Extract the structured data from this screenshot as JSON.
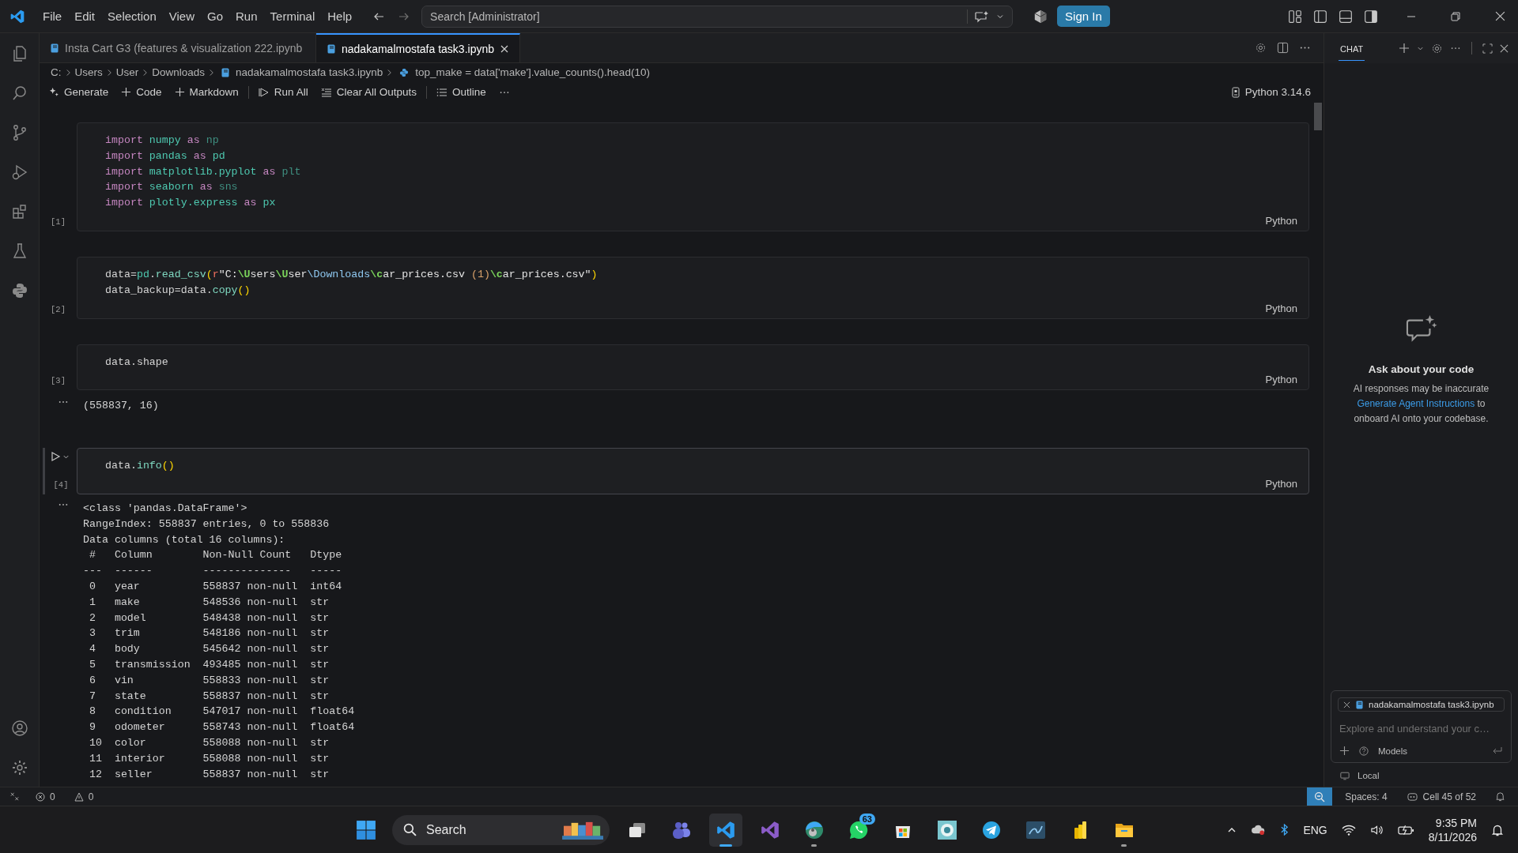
{
  "menu": [
    "File",
    "Edit",
    "Selection",
    "View",
    "Go",
    "Run",
    "Terminal",
    "Help"
  ],
  "search": {
    "placeholder": "Search [Administrator]"
  },
  "sign_in": "Sign In",
  "tabs": [
    {
      "label": "Insta Cart G3 (features & visualization 222.ipynb",
      "selected": false
    },
    {
      "label": "nadakamalmostafa task3.ipynb",
      "selected": true
    }
  ],
  "breadcrumb": [
    {
      "label": "C:",
      "kind": "folder"
    },
    {
      "label": "Users",
      "kind": "folder"
    },
    {
      "label": "User",
      "kind": "folder"
    },
    {
      "label": "Downloads",
      "kind": "folder"
    },
    {
      "label": "nadakamalmostafa task3.ipynb",
      "kind": "notebook"
    },
    {
      "label": "top_make = data['make'].value_counts().head(10)",
      "kind": "symbol"
    }
  ],
  "toolbar": [
    [
      {
        "label": "Generate",
        "kind": "generate"
      },
      {
        "label": "Code",
        "kind": "add"
      },
      {
        "label": "Markdown",
        "kind": "add"
      }
    ],
    [
      {
        "label": "Run All",
        "kind": "run"
      },
      {
        "label": "Clear All Outputs",
        "kind": "clear"
      }
    ],
    [
      {
        "label": "Outline",
        "kind": "outline"
      }
    ]
  ],
  "kernel": "Python 3.14.6",
  "cells": [
    {
      "count": "[1]",
      "language": "Python",
      "focused": false,
      "lines": [
        [
          {
            "text": "import ",
            "kind": "keyword"
          },
          {
            "text": "numpy ",
            "kind": "module"
          },
          {
            "text": "as ",
            "kind": "keyword"
          },
          {
            "text": "np",
            "kind": "alias_dim"
          }
        ],
        [
          {
            "text": "import ",
            "kind": "keyword"
          },
          {
            "text": "pandas ",
            "kind": "module"
          },
          {
            "text": "as ",
            "kind": "keyword"
          },
          {
            "text": "pd",
            "kind": "module"
          }
        ],
        [
          {
            "text": "import ",
            "kind": "keyword"
          },
          {
            "text": "matplotlib.pyplot ",
            "kind": "module"
          },
          {
            "text": "as ",
            "kind": "keyword"
          },
          {
            "text": "plt",
            "kind": "alias_dim"
          }
        ],
        [
          {
            "text": "import ",
            "kind": "keyword"
          },
          {
            "text": "seaborn ",
            "kind": "module"
          },
          {
            "text": "as ",
            "kind": "keyword"
          },
          {
            "text": "sns",
            "kind": "alias_dim"
          }
        ],
        [
          {
            "text": "import ",
            "kind": "keyword"
          },
          {
            "text": "plotly.express ",
            "kind": "module"
          },
          {
            "text": "as ",
            "kind": "keyword"
          },
          {
            "text": "px",
            "kind": "module"
          }
        ]
      ]
    },
    {
      "count": "[2]",
      "language": "Python",
      "focused": false,
      "lines": [
        [
          {
            "text": "data=",
            "kind": "plain"
          },
          {
            "text": "pd",
            "kind": "module"
          },
          {
            "text": ".",
            "kind": "plain"
          },
          {
            "text": "read_csv",
            "kind": "func"
          },
          {
            "text": "(",
            "kind": "paren"
          },
          {
            "text": "r",
            "kind": "prefix"
          },
          {
            "text": "\"C:",
            "kind": "string"
          },
          {
            "text": "\\U",
            "kind": "escape"
          },
          {
            "text": "sers",
            "kind": "string"
          },
          {
            "text": "\\U",
            "kind": "escape"
          },
          {
            "text": "ser",
            "kind": "string"
          },
          {
            "text": "\\Downloads",
            "kind": "path"
          },
          {
            "text": "\\c",
            "kind": "escape"
          },
          {
            "text": "ar_prices.csv ",
            "kind": "string"
          },
          {
            "text": "(1)",
            "kind": "string_paren"
          },
          {
            "text": "\\c",
            "kind": "escape"
          },
          {
            "text": "ar_prices.csv\"",
            "kind": "string"
          },
          {
            "text": ")",
            "kind": "paren"
          }
        ],
        [
          {
            "text": "data_backup=data.",
            "kind": "plain"
          },
          {
            "text": "copy",
            "kind": "func"
          },
          {
            "text": "()",
            "kind": "paren"
          }
        ]
      ]
    },
    {
      "count": "[3]",
      "language": "Python",
      "focused": false,
      "lines": [
        [
          {
            "text": "data.shape",
            "kind": "plain"
          }
        ]
      ],
      "output": [
        "(558837, 16)"
      ]
    },
    {
      "count": "[4]",
      "language": "Python",
      "focused": true,
      "lines": [
        [
          {
            "text": "data.",
            "kind": "plain"
          },
          {
            "text": "info",
            "kind": "func"
          },
          {
            "text": "()",
            "kind": "paren"
          }
        ]
      ],
      "output": [
        "<class 'pandas.DataFrame'>",
        "RangeIndex: 558837 entries, 0 to 558836",
        "Data columns (total 16 columns):",
        " #   Column        Non-Null Count   Dtype",
        "---  ------        --------------   -----",
        " 0   year          558837 non-null  int64",
        " 1   make          548536 non-null  str",
        " 2   model         548438 non-null  str",
        " 3   trim          548186 non-null  str",
        " 4   body          545642 non-null  str",
        " 5   transmission  493485 non-null  str",
        " 6   vin           558833 non-null  str",
        " 7   state         558837 non-null  str",
        " 8   condition     547017 non-null  float64",
        " 9   odometer      558743 non-null  float64",
        " 10  color         558088 non-null  str",
        " 11  interior      558088 non-null  str",
        " 12  seller        558837 non-null  str"
      ]
    }
  ],
  "chat": {
    "tab": "CHAT",
    "title": "Ask about your code",
    "note": "AI responses may be inaccurate",
    "link": "Generate Agent Instructions",
    "note_rest": "to onboard AI onto your codebase.",
    "attachment": "nadakamalmostafa task3.ipynb",
    "placeholder": "Explore and understand your c…",
    "models": "Models",
    "local": "Local"
  },
  "status": {
    "errors": "0",
    "warnings": "0",
    "spaces": "Spaces: 4",
    "cell": "Cell 45 of 52"
  },
  "taskbar": {
    "search": "Search",
    "apps": [
      {
        "kind": "taskview",
        "selected": false,
        "running": false
      },
      {
        "kind": "teams",
        "selected": false,
        "running": false
      },
      {
        "kind": "vscode",
        "selected": true,
        "running": true
      },
      {
        "kind": "vs",
        "selected": false,
        "running": false
      },
      {
        "kind": "browser",
        "selected": false,
        "running": true
      },
      {
        "kind": "whatsapp",
        "selected": false,
        "running": false,
        "badge": "63"
      },
      {
        "kind": "store",
        "selected": false,
        "running": false
      },
      {
        "kind": "pattern",
        "selected": false,
        "running": false
      },
      {
        "kind": "telegram",
        "selected": false,
        "running": false
      },
      {
        "kind": "workbench",
        "selected": false,
        "running": false
      },
      {
        "kind": "powerbi",
        "selected": false,
        "running": false
      },
      {
        "kind": "folder",
        "selected": false,
        "running": true
      }
    ],
    "language": "ENG",
    "time": "9:35 PM",
    "date": "8/11/2026"
  }
}
